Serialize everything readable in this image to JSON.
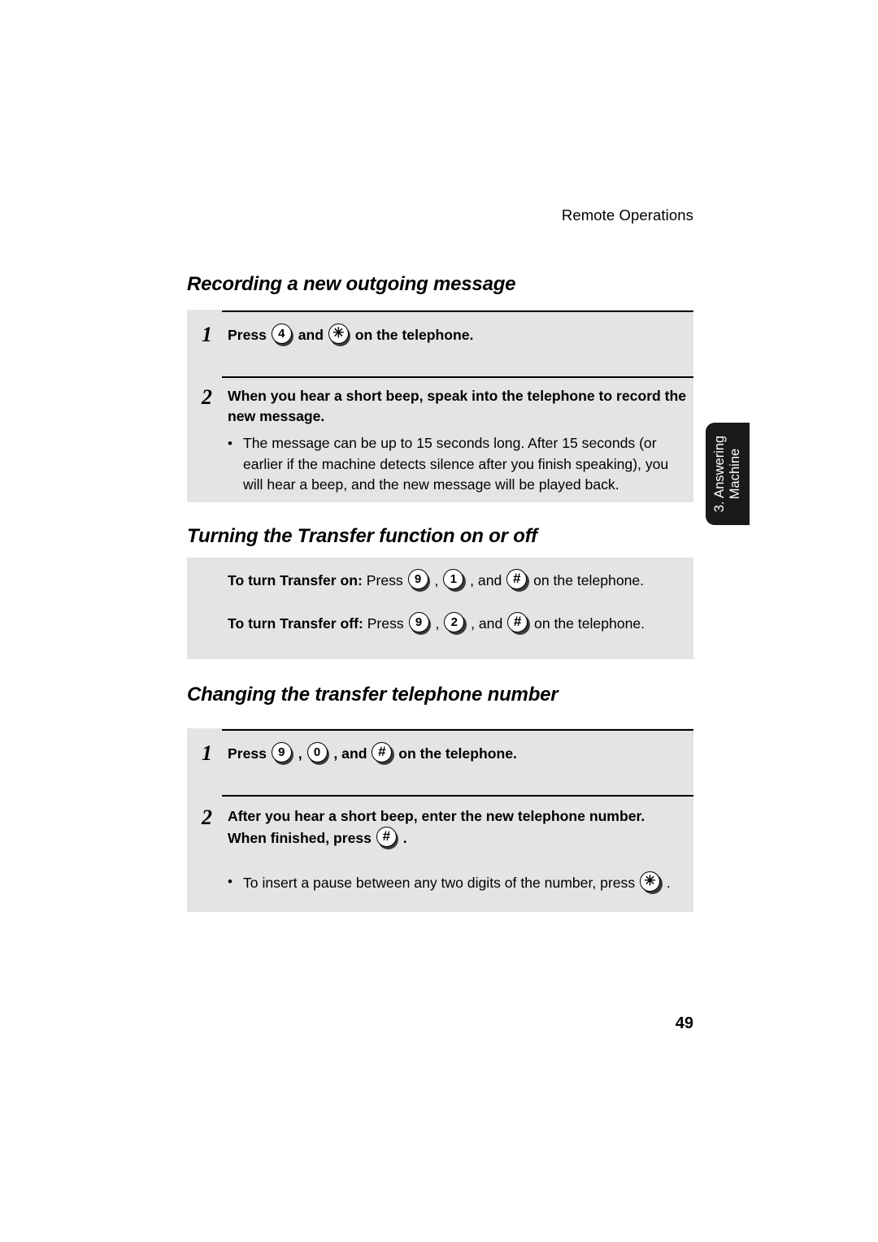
{
  "header": {
    "running_head": "Remote Operations"
  },
  "side_tab": {
    "line1": "3. Answering",
    "line2": "Machine"
  },
  "footer": {
    "page_number": "49"
  },
  "sections": [
    {
      "heading": "Recording a new outgoing message",
      "steps": [
        {
          "number": "1",
          "parts": [
            {
              "type": "text",
              "value": "Press "
            },
            {
              "type": "key",
              "value": "4"
            },
            {
              "type": "text",
              "value": " and "
            },
            {
              "type": "key",
              "value": "✳"
            },
            {
              "type": "text",
              "value": " on the telephone."
            }
          ],
          "bullets": []
        },
        {
          "number": "2",
          "parts": [
            {
              "type": "text",
              "value": "When you hear a short beep, speak into the telephone to record the new message."
            }
          ],
          "bullets": [
            "The message can be up to 15 seconds long. After 15 seconds (or earlier if the machine detects silence after you finish speaking), you will hear a beep, and the new message will be played back."
          ]
        }
      ]
    },
    {
      "heading": "Turning the Transfer function on or off",
      "lines": [
        {
          "parts": [
            {
              "type": "bold",
              "value": "To turn Transfer on:"
            },
            {
              "type": "text",
              "value": " Press "
            },
            {
              "type": "key",
              "value": "9"
            },
            {
              "type": "text",
              "value": " , "
            },
            {
              "type": "key",
              "value": "1"
            },
            {
              "type": "text",
              "value": " , and "
            },
            {
              "type": "key",
              "value": "#"
            },
            {
              "type": "text",
              "value": " on the telephone."
            }
          ]
        },
        {
          "parts": [
            {
              "type": "bold",
              "value": "To turn Transfer off:"
            },
            {
              "type": "text",
              "value": " Press "
            },
            {
              "type": "key",
              "value": "9"
            },
            {
              "type": "text",
              "value": " , "
            },
            {
              "type": "key",
              "value": "2"
            },
            {
              "type": "text",
              "value": " , and "
            },
            {
              "type": "key",
              "value": "#"
            },
            {
              "type": "text",
              "value": " on the telephone."
            }
          ]
        }
      ]
    },
    {
      "heading": "Changing the transfer telephone number",
      "steps": [
        {
          "number": "1",
          "parts": [
            {
              "type": "text",
              "value": "Press "
            },
            {
              "type": "key",
              "value": "9"
            },
            {
              "type": "text",
              "value": " , "
            },
            {
              "type": "key",
              "value": "0"
            },
            {
              "type": "text",
              "value": " , and "
            },
            {
              "type": "key",
              "value": "#"
            },
            {
              "type": "text",
              "value": " on the telephone."
            }
          ],
          "bullets": []
        },
        {
          "number": "2",
          "parts": [
            {
              "type": "text",
              "value": "After you hear a short beep, enter the new telephone number. When finished, press "
            },
            {
              "type": "key",
              "value": "#"
            },
            {
              "type": "text",
              "value": " ."
            }
          ],
          "bullets": [
            {
              "parts": [
                {
                  "type": "text",
                  "value": "To insert a pause between any two digits of the number, press "
                },
                {
                  "type": "key",
                  "value": "✳"
                },
                {
                  "type": "text",
                  "value": " ."
                }
              ]
            }
          ]
        }
      ]
    }
  ]
}
